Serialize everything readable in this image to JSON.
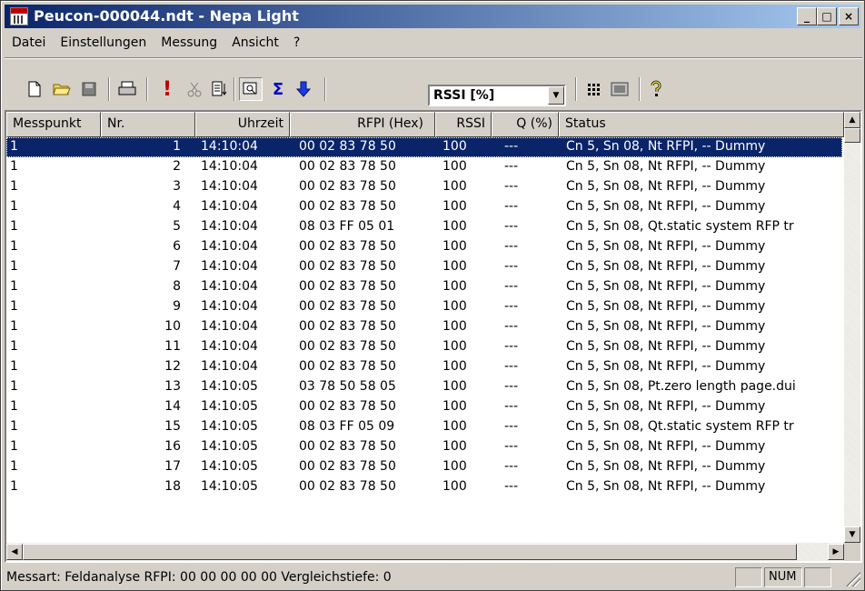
{
  "window": {
    "title": "Peucon-000044.ndt - Nepa Light",
    "buttons": {
      "minimize": "_",
      "maximize": "□",
      "close": "×"
    }
  },
  "menu": [
    {
      "label": "Datei"
    },
    {
      "label": "Einstellungen"
    },
    {
      "label": "Messung"
    },
    {
      "label": "Ansicht"
    },
    {
      "label": "?"
    }
  ],
  "toolbar": {
    "icons": [
      "new-document-icon",
      "open-folder-icon",
      "save-icon",
      "print-icon",
      "alert-icon",
      "cut-icon",
      "sort-icon",
      "find-icon",
      "sum-icon",
      "arrow-down-icon",
      "grid-icon",
      "device-icon",
      "help-icon"
    ],
    "combo_value": "RSSI [%]"
  },
  "table": {
    "columns": [
      "Messpunkt",
      "Nr.",
      "Uhrzeit",
      "RFPI (Hex)",
      "RSSI",
      "Q (%)",
      "Status"
    ],
    "rows": [
      [
        "1",
        "1",
        "14:10:04",
        "00 02 83 78 50",
        "100",
        "---",
        "Cn 5, Sn 08, Nt RFPI, -- Dummy"
      ],
      [
        "1",
        "2",
        "14:10:04",
        "00 02 83 78 50",
        "100",
        "---",
        "Cn 5, Sn 08, Nt RFPI, -- Dummy"
      ],
      [
        "1",
        "3",
        "14:10:04",
        "00 02 83 78 50",
        "100",
        "---",
        "Cn 5, Sn 08, Nt RFPI, -- Dummy"
      ],
      [
        "1",
        "4",
        "14:10:04",
        "00 02 83 78 50",
        "100",
        "---",
        "Cn 5, Sn 08, Nt RFPI, -- Dummy"
      ],
      [
        "1",
        "5",
        "14:10:04",
        "08 03 FF 05 01",
        "100",
        "---",
        "Cn 5, Sn 08, Qt.static system RFP tr"
      ],
      [
        "1",
        "6",
        "14:10:04",
        "00 02 83 78 50",
        "100",
        "---",
        "Cn 5, Sn 08, Nt RFPI, -- Dummy"
      ],
      [
        "1",
        "7",
        "14:10:04",
        "00 02 83 78 50",
        "100",
        "---",
        "Cn 5, Sn 08, Nt RFPI, -- Dummy"
      ],
      [
        "1",
        "8",
        "14:10:04",
        "00 02 83 78 50",
        "100",
        "---",
        "Cn 5, Sn 08, Nt RFPI, -- Dummy"
      ],
      [
        "1",
        "9",
        "14:10:04",
        "00 02 83 78 50",
        "100",
        "---",
        "Cn 5, Sn 08, Nt RFPI, -- Dummy"
      ],
      [
        "1",
        "10",
        "14:10:04",
        "00 02 83 78 50",
        "100",
        "---",
        "Cn 5, Sn 08, Nt RFPI, -- Dummy"
      ],
      [
        "1",
        "11",
        "14:10:04",
        "00 02 83 78 50",
        "100",
        "---",
        "Cn 5, Sn 08, Nt RFPI, -- Dummy"
      ],
      [
        "1",
        "12",
        "14:10:04",
        "00 02 83 78 50",
        "100",
        "---",
        "Cn 5, Sn 08, Nt RFPI, -- Dummy"
      ],
      [
        "1",
        "13",
        "14:10:05",
        "03 78 50 58 05",
        "100",
        "---",
        "Cn 5, Sn 08, Pt.zero length page.dui"
      ],
      [
        "1",
        "14",
        "14:10:05",
        "00 02 83 78 50",
        "100",
        "---",
        "Cn 5, Sn 08, Nt RFPI, -- Dummy"
      ],
      [
        "1",
        "15",
        "14:10:05",
        "08 03 FF 05 09",
        "100",
        "---",
        "Cn 5, Sn 08, Qt.static system RFP tr"
      ],
      [
        "1",
        "16",
        "14:10:05",
        "00 02 83 78 50",
        "100",
        "---",
        "Cn 5, Sn 08, Nt RFPI, -- Dummy"
      ],
      [
        "1",
        "17",
        "14:10:05",
        "00 02 83 78 50",
        "100",
        "---",
        "Cn 5, Sn 08, Nt RFPI, -- Dummy"
      ],
      [
        "1",
        "18",
        "14:10:05",
        "00 02 83 78 50",
        "100",
        "---",
        "Cn 5, Sn 08, Nt RFPI, -- Dummy"
      ]
    ],
    "selected_row": 0
  },
  "statusbar": {
    "text": "Messart: Feldanalyse  RFPI: 00 00 00 00 00  Vergleichstiefe: 0",
    "panel1": "",
    "panel2": "NUM",
    "panel3": ""
  },
  "colors": {
    "title_gradient_start": "#0a246a",
    "title_gradient_end": "#a6caf0",
    "selection": "#0a246a",
    "face": "#d4d0c8"
  }
}
